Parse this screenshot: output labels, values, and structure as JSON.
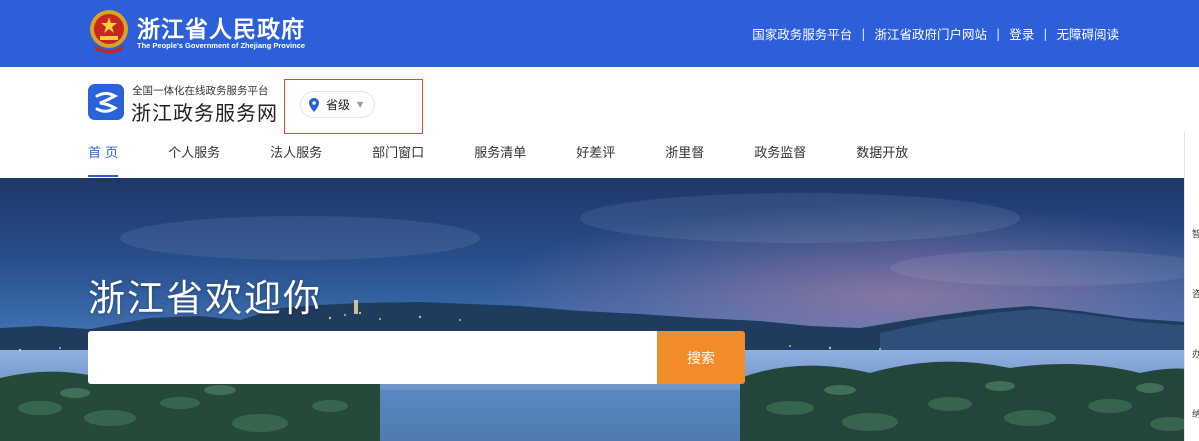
{
  "topbar": {
    "title": "浙江省人民政府",
    "subtitle": "The People's Government of Zhejiang Province",
    "links": [
      {
        "label": "国家政务服务平台"
      },
      {
        "label": "浙江省政府门户网站"
      },
      {
        "label": "登录"
      },
      {
        "label": "无障碍阅读"
      }
    ],
    "separator": "|"
  },
  "header": {
    "logo_small": "全国一体化在线政务服务平台",
    "logo_big": "浙江政务服务网",
    "region": "省级",
    "nav": [
      {
        "label": "首 页",
        "active": true
      },
      {
        "label": "个人服务"
      },
      {
        "label": "法人服务"
      },
      {
        "label": "部门窗口"
      },
      {
        "label": "服务清单"
      },
      {
        "label": "好差评"
      },
      {
        "label": "浙里督"
      },
      {
        "label": "政务监督"
      },
      {
        "label": "数据开放"
      }
    ]
  },
  "hero": {
    "title": "浙江省欢迎你",
    "search_placeholder": "",
    "search_button": "搜索"
  },
  "side_panel": {
    "items": [
      "智",
      "咨",
      "办",
      "纳"
    ]
  },
  "colors": {
    "primary": "#2c5fd9",
    "search_button": "#f28b2a",
    "region_highlight": "#e04a3a"
  }
}
